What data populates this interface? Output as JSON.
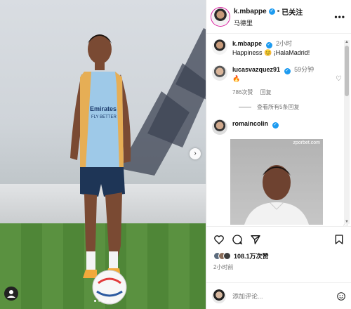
{
  "header": {
    "username": "k.mbappe",
    "separator": "•",
    "follow_label": "已关注",
    "location": "马德里",
    "more_icon": "more-horizontal-icon"
  },
  "photo": {
    "next_icon": "chevron-right-icon",
    "tag_icon": "person-tag-icon"
  },
  "caption": {
    "username": "k.mbappe",
    "time": "2小时",
    "text": "Happiness 😊 ¡HalaMadrid!"
  },
  "comments": [
    {
      "username": "lucasvazquez91",
      "time": "59分钟",
      "text": "🔥",
      "likes": "786次赞",
      "reply_label": "回复",
      "view_replies": "查看所有5条回复"
    },
    {
      "username": "romaincolin",
      "gif_watermark": "zporbet.com"
    }
  ],
  "actions": {
    "like_icon": "heart-icon",
    "comment_icon": "comment-icon",
    "share_icon": "send-icon",
    "save_icon": "bookmark-icon"
  },
  "likes": {
    "count": "108.1万次赞"
  },
  "post_time": "2小时前",
  "add_comment": {
    "placeholder": "添加评论..."
  },
  "colors": {
    "verified": "#1d9bf0",
    "secondary_text": "#737373",
    "jersey": "#9ec9e8",
    "pitch": "#4f8134"
  }
}
